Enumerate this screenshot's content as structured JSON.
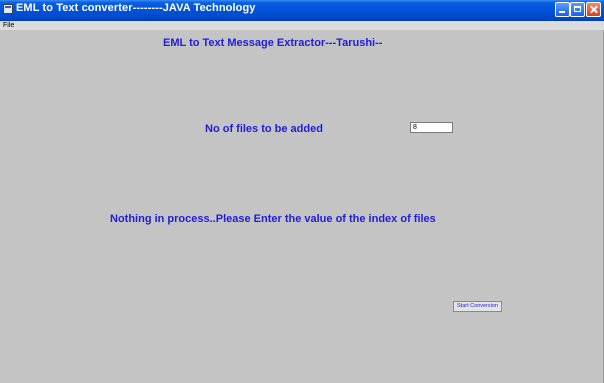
{
  "window": {
    "title": "EML to Text converter--------JAVA Technology"
  },
  "menubar": {
    "items": [
      "File"
    ]
  },
  "main": {
    "heading": "EML to Text Message Extractor---Tarushi--",
    "files_label": "No of files to be added",
    "files_input_value": "8",
    "status_message": "Nothing in process..Please Enter the value of the index of files",
    "start_button_label": "Start Conversion"
  },
  "colors": {
    "titlebar": "#0052d8",
    "background": "#c4c4c4",
    "label_blue": "#1e1edc"
  },
  "icons": [
    "app-icon",
    "minimize-icon",
    "maximize-icon",
    "close-icon"
  ]
}
